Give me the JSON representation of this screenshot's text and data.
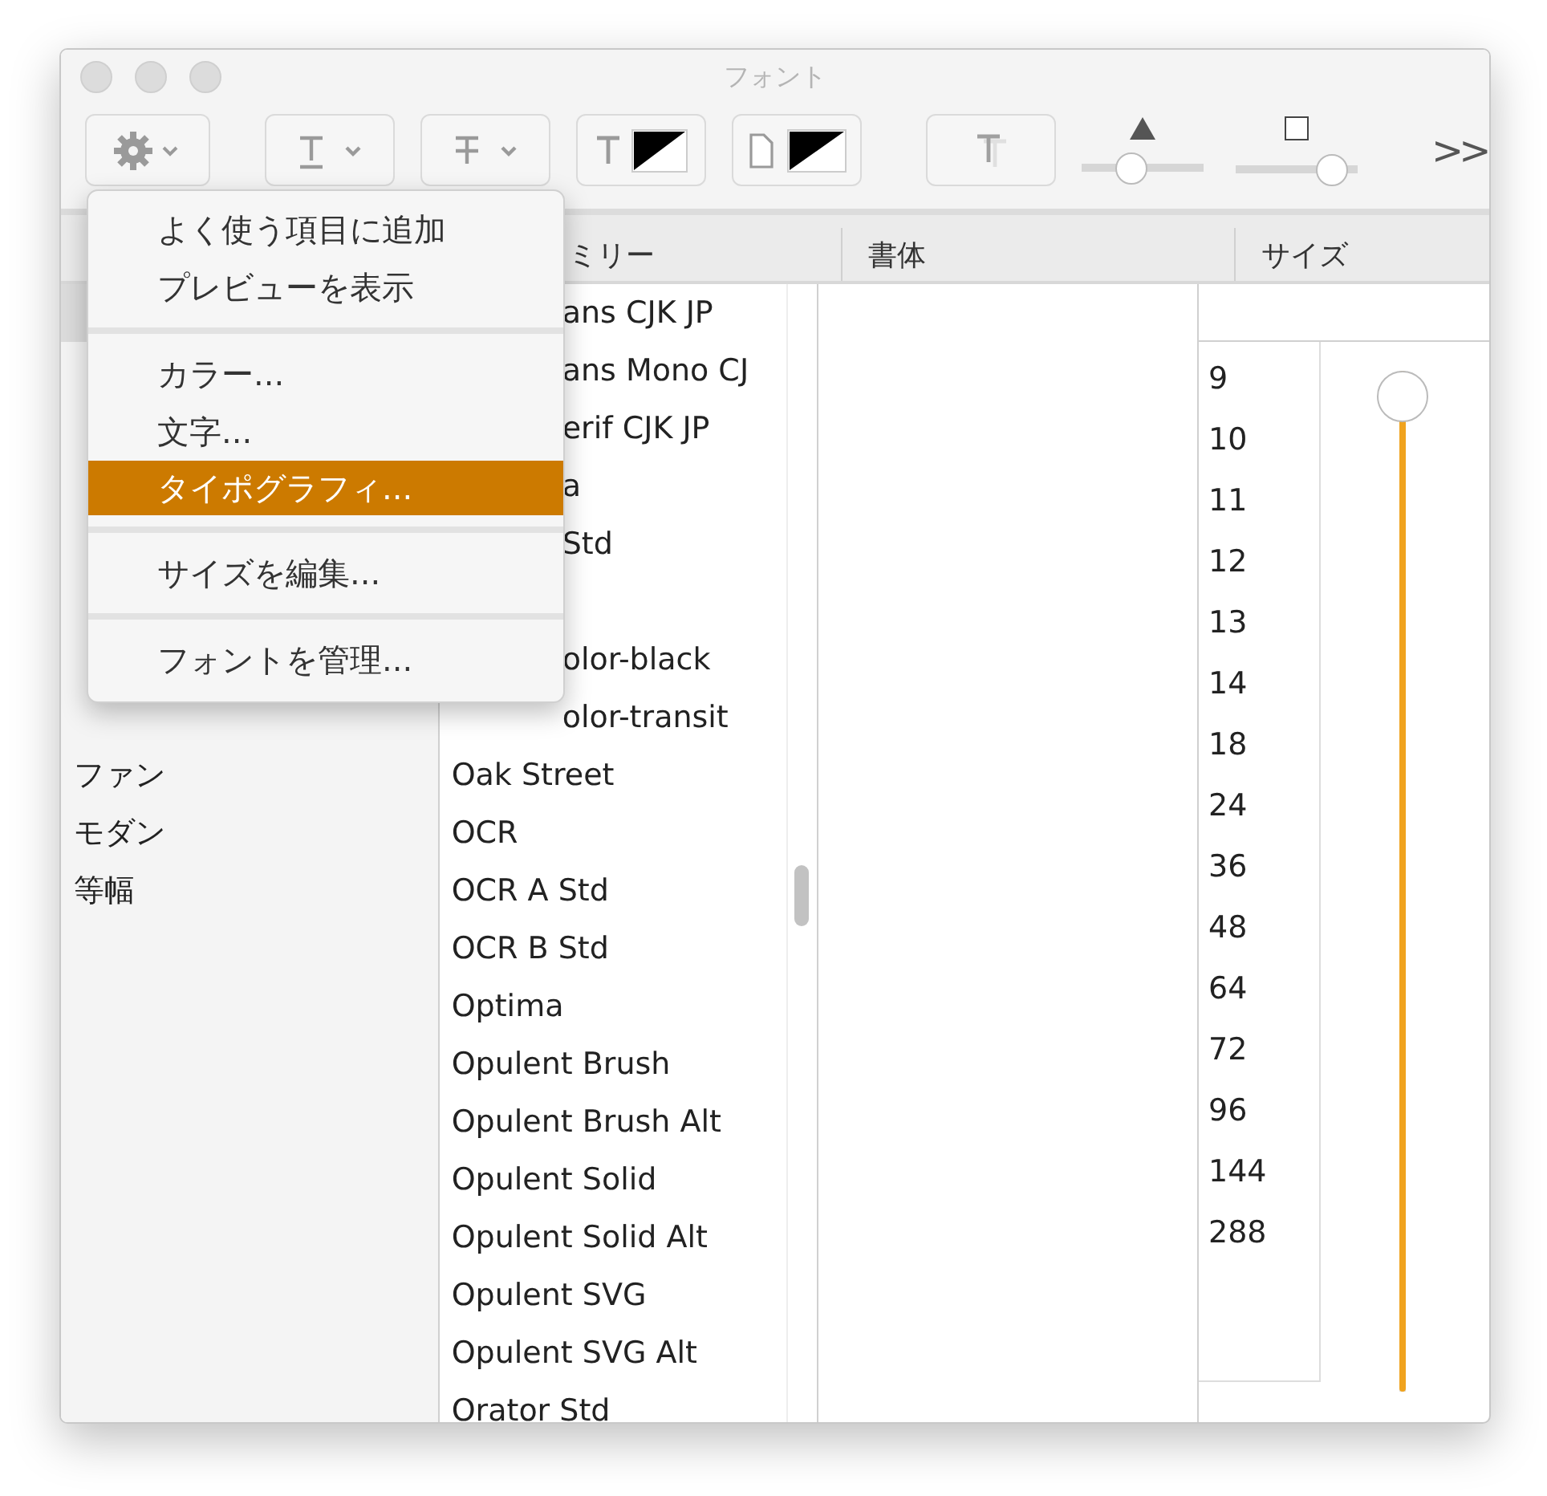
{
  "window": {
    "title": "フォント"
  },
  "toolbar": {
    "sliders": [
      {
        "kind": "shadow-opacity",
        "level": 0.37
      },
      {
        "kind": "shadow-blur",
        "level": 0.9
      }
    ],
    "overflow": ">>"
  },
  "menu": {
    "items": [
      {
        "kind": "item",
        "label": "よく使う項目に追加",
        "selected": false
      },
      {
        "kind": "item",
        "label": "プレビューを表示",
        "selected": false
      },
      {
        "kind": "separator"
      },
      {
        "kind": "item",
        "label": "カラー...",
        "selected": false
      },
      {
        "kind": "item",
        "label": "文字...",
        "selected": false
      },
      {
        "kind": "item",
        "label": "タイポグラフィ...",
        "selected": true
      },
      {
        "kind": "separator"
      },
      {
        "kind": "item",
        "label": "サイズを編集...",
        "selected": false
      },
      {
        "kind": "separator"
      },
      {
        "kind": "item",
        "label": "フォントを管理...",
        "selected": false
      }
    ]
  },
  "columns": {
    "family": "ミリー",
    "typeface": "書体",
    "size": "サイズ"
  },
  "collections": [
    {
      "kind": "covered",
      "selected": true
    },
    {
      "kind": "covered",
      "selected": false
    },
    {
      "kind": "covered",
      "selected": false
    },
    {
      "kind": "covered",
      "selected": false
    },
    {
      "kind": "covered",
      "selected": false
    },
    {
      "kind": "covered",
      "selected": false
    },
    {
      "kind": "covered",
      "selected": false
    },
    {
      "kind": "covered",
      "selected": false
    },
    {
      "kind": "full",
      "label": "ファン",
      "selected": false
    },
    {
      "kind": "full",
      "label": "モダン",
      "selected": false
    },
    {
      "kind": "full",
      "label": "等幅",
      "selected": false
    }
  ],
  "families": [
    {
      "kind": "partial",
      "label": "ans CJK JP"
    },
    {
      "kind": "partial",
      "label": "ans Mono CJ"
    },
    {
      "kind": "partial",
      "label": "erif CJK JP"
    },
    {
      "kind": "partial",
      "label": "a"
    },
    {
      "kind": "partial",
      "label": "Std"
    },
    {
      "kind": "covered"
    },
    {
      "kind": "partial",
      "label": "olor-black"
    },
    {
      "kind": "partial",
      "label": "olor-transit"
    },
    {
      "kind": "full",
      "label": "Oak Street"
    },
    {
      "kind": "full",
      "label": "OCR"
    },
    {
      "kind": "full",
      "label": "OCR A Std"
    },
    {
      "kind": "full",
      "label": "OCR B Std"
    },
    {
      "kind": "full",
      "label": "Optima"
    },
    {
      "kind": "full",
      "label": "Opulent Brush"
    },
    {
      "kind": "full",
      "label": "Opulent Brush Alt"
    },
    {
      "kind": "full",
      "label": "Opulent Solid"
    },
    {
      "kind": "full",
      "label": "Opulent Solid Alt"
    },
    {
      "kind": "full",
      "label": "Opulent SVG"
    },
    {
      "kind": "full",
      "label": "Opulent SVG Alt"
    },
    {
      "kind": "full",
      "label": "Orator Std"
    }
  ],
  "sizes": [
    "9",
    "10",
    "11",
    "12",
    "13",
    "14",
    "18",
    "24",
    "36",
    "48",
    "64",
    "72",
    "96",
    "144",
    "288"
  ],
  "size_slider": {
    "level": 1
  }
}
